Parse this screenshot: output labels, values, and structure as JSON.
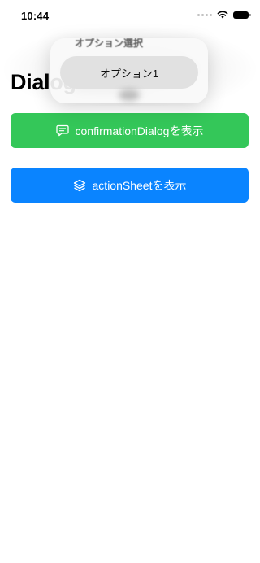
{
  "status_bar": {
    "time": "10:44"
  },
  "page": {
    "title": "Dialog"
  },
  "buttons": {
    "confirmation_dialog_label": "confirmationDialogを表示",
    "action_sheet_label": "actionSheetを表示"
  },
  "popover": {
    "title": "オプション選択",
    "options": [
      "オプション1"
    ]
  },
  "colors": {
    "confirmation_button": "#34c759",
    "action_sheet_button": "#0a84ff",
    "option_item_bg": "#e1e1e1"
  },
  "icons": {
    "confirmation_button_icon": "message-bubble-icon",
    "action_sheet_button_icon": "layers-stack-icon"
  }
}
